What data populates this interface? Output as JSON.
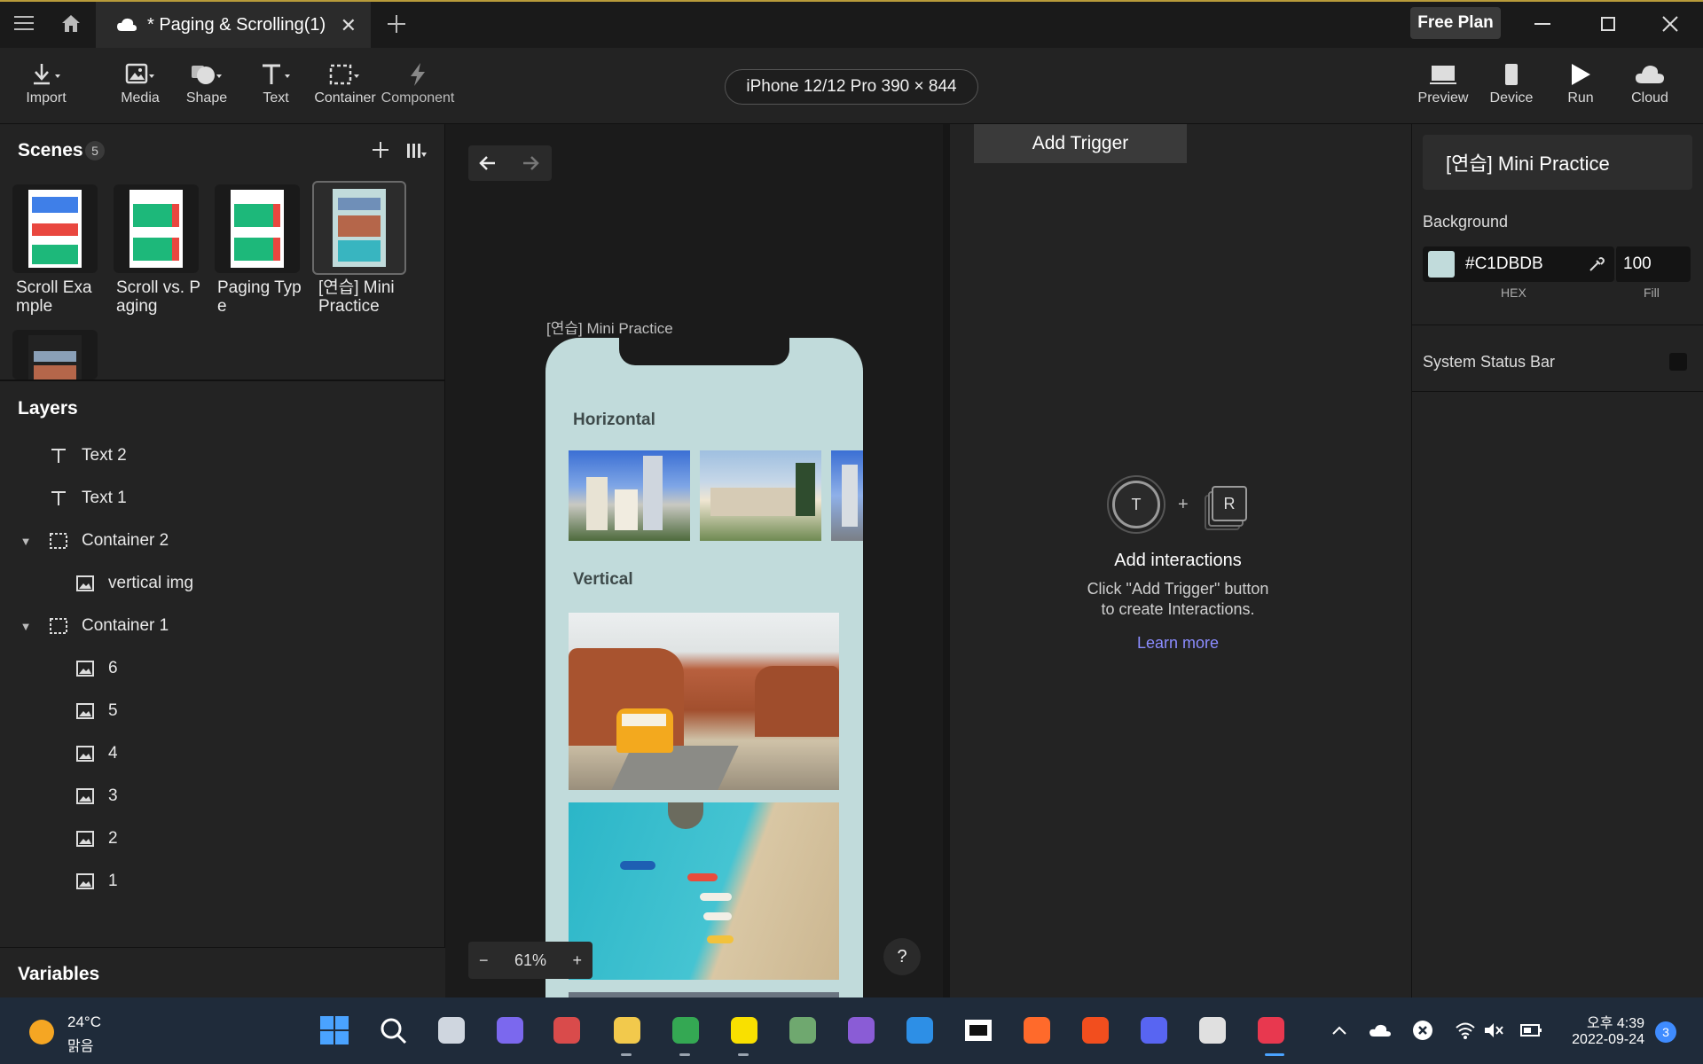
{
  "titlebar": {
    "tab_title": "* Paging & Scrolling(1)",
    "close_tab": "✕",
    "plan_label": "Free Plan"
  },
  "toolbar": {
    "tools": [
      "Import",
      "Media",
      "Shape",
      "Text",
      "Container",
      "Component"
    ],
    "device": "iPhone 12/12 Pro  390 × 844",
    "actions": [
      "Preview",
      "Device",
      "Run",
      "Cloud"
    ]
  },
  "scenes": {
    "title": "Scenes",
    "count": "5",
    "items": [
      {
        "label": "Scroll Exa\nmple"
      },
      {
        "label": "Scroll vs. P\naging"
      },
      {
        "label": "Paging Typ\ne"
      },
      {
        "label": "[연습] Mini\nPractice",
        "selected": true
      },
      {
        "label": ""
      }
    ]
  },
  "layers": {
    "title": "Layers",
    "items": [
      {
        "label": "Text 2",
        "icon": "text-icon"
      },
      {
        "label": "Text 1",
        "icon": "text-icon"
      },
      {
        "label": "Container 2",
        "icon": "container-icon",
        "expanded": true
      },
      {
        "label": "vertical img",
        "icon": "image-icon"
      },
      {
        "label": "Container 1",
        "icon": "container-icon",
        "expanded": true
      },
      {
        "label": "6",
        "icon": "image-icon"
      },
      {
        "label": "5",
        "icon": "image-icon"
      },
      {
        "label": "4",
        "icon": "image-icon"
      },
      {
        "label": "3",
        "icon": "image-icon"
      },
      {
        "label": "2",
        "icon": "image-icon"
      },
      {
        "label": "1",
        "icon": "image-icon"
      }
    ]
  },
  "variables": {
    "title": "Variables"
  },
  "canvas": {
    "frame_label": "[연습] Mini Practice",
    "horizontal_title": "Horizontal",
    "vertical_title": "Vertical",
    "zoom": "61%",
    "zoom_minus": "−",
    "zoom_plus": "+",
    "help": "?"
  },
  "interactions": {
    "add_trigger": "Add Trigger",
    "trigger_letter": "T",
    "plus": "+",
    "response_letter": "R",
    "empty_title": "Add interactions",
    "empty_desc_1": "Click \"Add Trigger\" button",
    "empty_desc_2": "to create Interactions.",
    "learn_more": "Learn more"
  },
  "properties": {
    "scene_name": "[연습] Mini Practice",
    "background_label": "Background",
    "hex": "#C1DBDB",
    "fill": "100",
    "hex_caption": "HEX",
    "fill_caption": "Fill",
    "status_bar_label": "System Status Bar",
    "background_color": "#C1DBDB"
  },
  "taskbar": {
    "temperature": "24°C",
    "condition": "맑음",
    "time": "오후 4:39",
    "date": "2022-09-24",
    "notifications": "3",
    "apps": [
      "start-icon",
      "search-icon",
      "task-view-icon",
      "teams-icon",
      "toolbox-icon",
      "file-explorer-icon",
      "chrome-icon",
      "kakaotalk-icon",
      "files-icon",
      "visual-studio-icon",
      "vscode-icon",
      "7zip-icon",
      "pen-app-icon",
      "figma-icon",
      "discord-icon",
      "clip-studio-icon",
      "protopie-icon"
    ]
  },
  "colors": {
    "accent_link": "#8B8CFF",
    "phone_bg": "#C1DBDB",
    "green_block": "#1DB87A",
    "red_block": "#E9473F",
    "blue_block": "#3F7FE8"
  }
}
